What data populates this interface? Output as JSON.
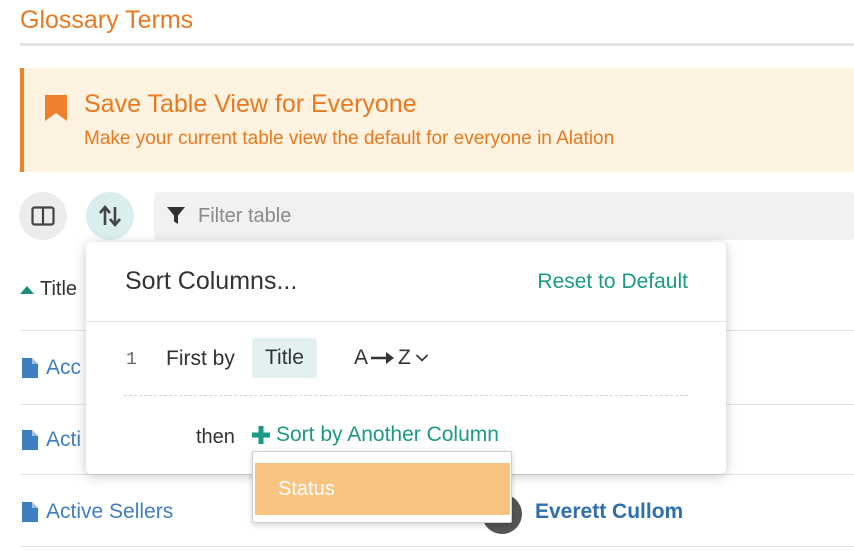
{
  "page": {
    "title": "Glossary Terms"
  },
  "banner": {
    "title": "Save Table View for Everyone",
    "subtitle": "Make your current table view the default for everyone in Alation",
    "icon": "bookmark-icon"
  },
  "toolbar": {
    "columns_icon": "columns-icon",
    "sort_icon": "sort-arrows-icon",
    "filter_placeholder": "Filter table",
    "filter_value": ""
  },
  "table": {
    "column_header": "Title",
    "sort_direction": "ascending",
    "rows": [
      {
        "title": "Acc",
        "owner": ""
      },
      {
        "title": "Acti",
        "owner": ""
      },
      {
        "title": "Active Sellers",
        "owner": "Everett Cullom"
      }
    ]
  },
  "sort_popup": {
    "title": "Sort Columns...",
    "reset_label": "Reset to Default",
    "rules": [
      {
        "order": "1",
        "prefix": "First by",
        "column": "Title",
        "dir_from": "A",
        "dir_to": "Z"
      }
    ],
    "then_label": "then",
    "add_label": "Sort by Another Column",
    "dropdown_options": [
      "Status"
    ]
  },
  "colors": {
    "accent_orange": "#e9781f",
    "teal": "#1a9a86",
    "link_blue": "#3f7fc1",
    "highlight_option": "#f9c47f"
  }
}
